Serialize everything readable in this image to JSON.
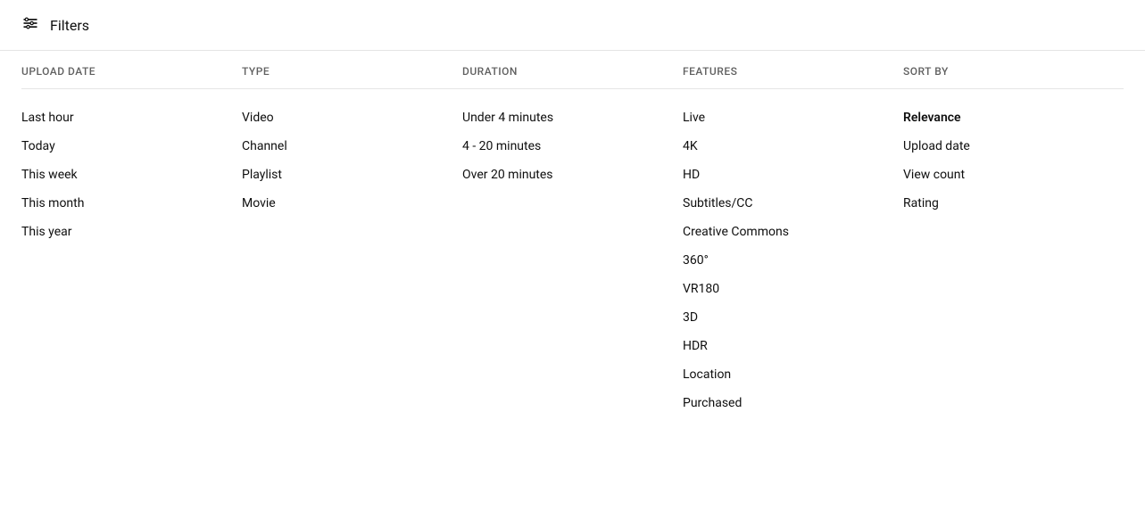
{
  "header": {
    "icon_label": "filters-adjust-icon",
    "title": "Filters"
  },
  "columns": [
    {
      "id": "upload-date",
      "header": "UPLOAD DATE",
      "items": [
        {
          "label": "Last hour",
          "active": false
        },
        {
          "label": "Today",
          "active": false
        },
        {
          "label": "This week",
          "active": false
        },
        {
          "label": "This month",
          "active": false
        },
        {
          "label": "This year",
          "active": false
        }
      ]
    },
    {
      "id": "type",
      "header": "TYPE",
      "items": [
        {
          "label": "Video",
          "active": false
        },
        {
          "label": "Channel",
          "active": false
        },
        {
          "label": "Playlist",
          "active": false
        },
        {
          "label": "Movie",
          "active": false
        }
      ]
    },
    {
      "id": "duration",
      "header": "DURATION",
      "items": [
        {
          "label": "Under 4 minutes",
          "active": false
        },
        {
          "label": "4 - 20 minutes",
          "active": false
        },
        {
          "label": "Over 20 minutes",
          "active": false
        }
      ]
    },
    {
      "id": "features",
      "header": "FEATURES",
      "items": [
        {
          "label": "Live",
          "active": false
        },
        {
          "label": "4K",
          "active": false
        },
        {
          "label": "HD",
          "active": false
        },
        {
          "label": "Subtitles/CC",
          "active": false
        },
        {
          "label": "Creative Commons",
          "active": false
        },
        {
          "label": "360°",
          "active": false
        },
        {
          "label": "VR180",
          "active": false
        },
        {
          "label": "3D",
          "active": false
        },
        {
          "label": "HDR",
          "active": false
        },
        {
          "label": "Location",
          "active": false
        },
        {
          "label": "Purchased",
          "active": false
        }
      ]
    },
    {
      "id": "sort-by",
      "header": "SORT BY",
      "items": [
        {
          "label": "Relevance",
          "active": true
        },
        {
          "label": "Upload date",
          "active": false
        },
        {
          "label": "View count",
          "active": false
        },
        {
          "label": "Rating",
          "active": false
        }
      ]
    }
  ]
}
